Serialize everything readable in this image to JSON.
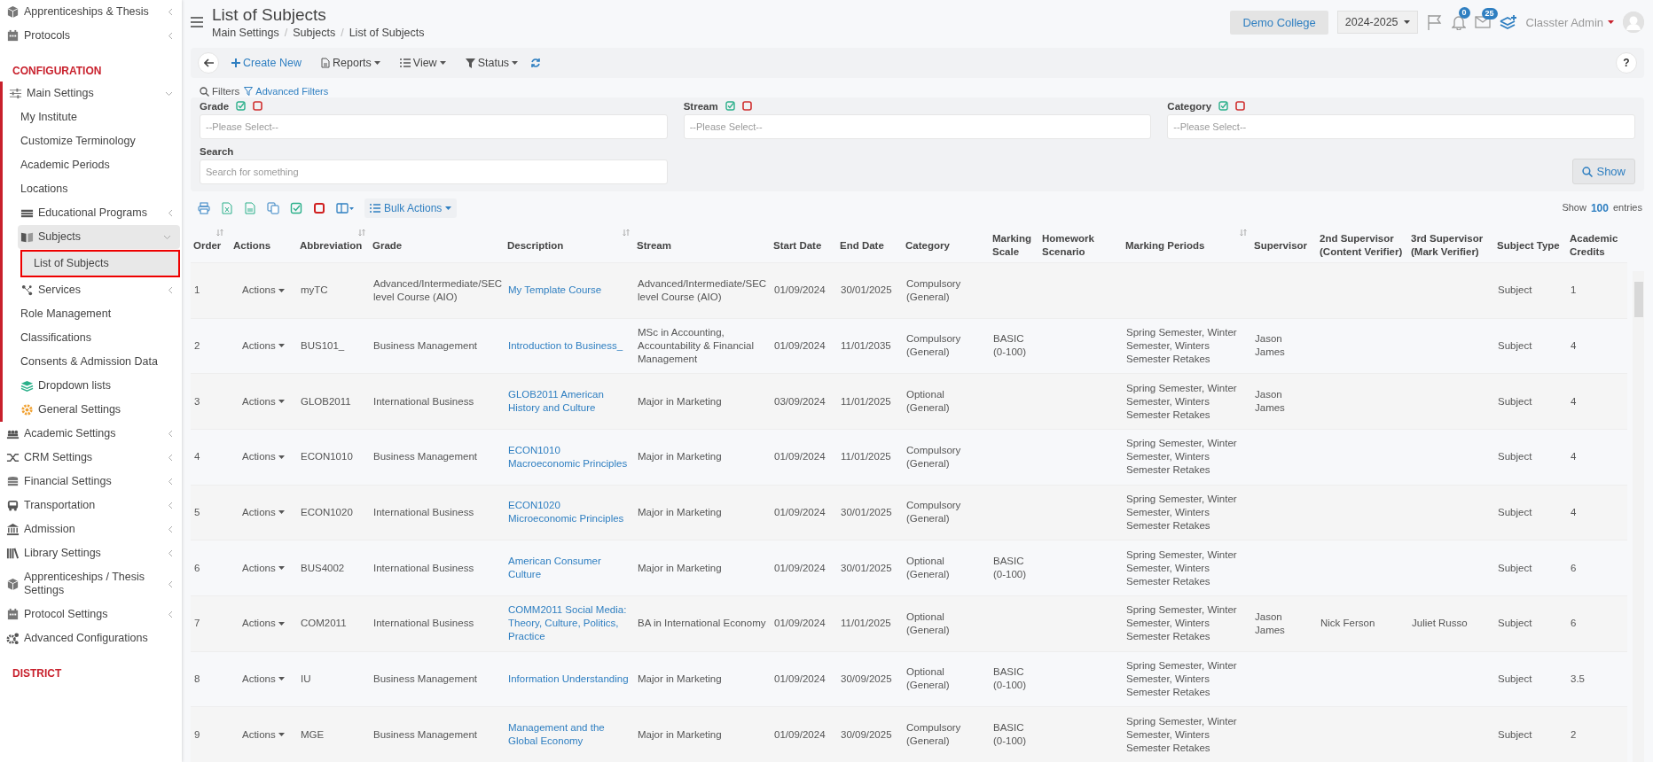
{
  "sidebar": {
    "items": [
      {
        "label": "Apprenticeships & Thesis",
        "kind": "item",
        "expanded": false,
        "selected": false
      },
      {
        "label": "Protocols",
        "kind": "item",
        "expanded": false,
        "selected": false
      },
      {
        "label": "CONFIGURATION",
        "kind": "section"
      },
      {
        "label": "Main Settings",
        "kind": "item",
        "expanded": true,
        "selected": false,
        "children": [
          {
            "label": "My Institute",
            "selected": false
          },
          {
            "label": "Customize Terminology",
            "selected": false
          },
          {
            "label": "Academic Periods",
            "selected": false
          },
          {
            "label": "Locations",
            "selected": false
          },
          {
            "label": "Educational Programs",
            "expanded": false,
            "selected": false
          },
          {
            "label": "Subjects",
            "expanded": true,
            "selected": false,
            "children": [
              {
                "label": "List of Subjects",
                "selected": true
              }
            ]
          },
          {
            "label": "Services",
            "expanded": false,
            "selected": false
          },
          {
            "label": "Role Management",
            "selected": false
          },
          {
            "label": "Classifications",
            "selected": false
          },
          {
            "label": "Consents & Admission Data",
            "selected": false
          },
          {
            "label": "Dropdown lists",
            "selected": false
          },
          {
            "label": "General Settings",
            "selected": false
          }
        ]
      },
      {
        "label": "Academic Settings",
        "kind": "item",
        "expanded": false,
        "selected": false
      },
      {
        "label": "CRM Settings",
        "kind": "item",
        "expanded": false,
        "selected": false
      },
      {
        "label": "Financial Settings",
        "kind": "item",
        "expanded": false,
        "selected": false
      },
      {
        "label": "Transportation",
        "kind": "item",
        "expanded": false,
        "selected": false
      },
      {
        "label": "Admission",
        "kind": "item",
        "expanded": false,
        "selected": false
      },
      {
        "label": "Library Settings",
        "kind": "item",
        "expanded": false,
        "selected": false
      },
      {
        "label": "Apprenticeships / Thesis Settings",
        "kind": "item",
        "expanded": false,
        "selected": false
      },
      {
        "label": "Protocol Settings",
        "kind": "item",
        "expanded": false,
        "selected": false
      },
      {
        "label": "Advanced Configurations",
        "kind": "item",
        "selected": false
      },
      {
        "label": "DISTRICT",
        "kind": "section"
      }
    ]
  },
  "header": {
    "title": "List of Subjects",
    "breadcrumbs": [
      "Main Settings",
      "Subjects",
      "List of Subjects"
    ],
    "breadcrumb_separator": "/",
    "institution": "Demo College",
    "year": "2024-2025",
    "notifications": "0",
    "messages": "25",
    "user": "Classter Admin"
  },
  "toolbar": {
    "buttons": [
      {
        "label": "Create New",
        "kind": "create"
      },
      {
        "label": "Reports",
        "kind": "reports"
      },
      {
        "label": "View",
        "kind": "view"
      },
      {
        "label": "Status",
        "kind": "status"
      }
    ],
    "help": "?"
  },
  "filters": {
    "title": "Filters",
    "advanced": "Advanced Filters",
    "fields": [
      {
        "label": "Grade",
        "placeholder": "--Please Select--"
      },
      {
        "label": "Stream",
        "placeholder": "--Please Select--"
      },
      {
        "label": "Category",
        "placeholder": "--Please Select--"
      }
    ],
    "search": {
      "label": "Search",
      "placeholder": "Search for something"
    },
    "show_button": "Show"
  },
  "table": {
    "bulk_actions": "Bulk Actions",
    "length": {
      "prefix": "Show",
      "value": "100",
      "suffix": "entries"
    },
    "columns": [
      {
        "label": "Order",
        "sortable": true,
        "kind": "text"
      },
      {
        "label": "Actions",
        "sortable": false,
        "kind": "actions"
      },
      {
        "label": "Abbreviation",
        "sortable": true,
        "kind": "text"
      },
      {
        "label": "Grade",
        "sortable": false,
        "kind": "text"
      },
      {
        "label": "Description",
        "sortable": true,
        "kind": "link"
      },
      {
        "label": "Stream",
        "sortable": false,
        "kind": "text"
      },
      {
        "label": "Start Date",
        "sortable": false,
        "kind": "text"
      },
      {
        "label": "End Date",
        "sortable": false,
        "kind": "text"
      },
      {
        "label": "Category",
        "sortable": false,
        "kind": "text"
      },
      {
        "label": "Marking Scale",
        "sortable": false,
        "kind": "text"
      },
      {
        "label": "Homework Scenario",
        "sortable": false,
        "kind": "text"
      },
      {
        "label": "Marking Periods",
        "sortable": true,
        "kind": "text"
      },
      {
        "label": "Supervisor",
        "sortable": false,
        "kind": "text"
      },
      {
        "label": "2nd Supervisor (Content Verifier)",
        "sortable": false,
        "kind": "text"
      },
      {
        "label": "3rd Supervisor (Mark Verifier)",
        "sortable": false,
        "kind": "text"
      },
      {
        "label": "Subject Type",
        "sortable": false,
        "kind": "text"
      },
      {
        "label": "Academic Credits",
        "sortable": false,
        "kind": "text"
      }
    ],
    "rows": [
      [
        "1",
        "Actions",
        "myTC",
        "Advanced/Intermediate/SEC level Course (AIO)",
        "My Template Course",
        "Advanced/Intermediate/SEC level Course (AIO)",
        "01/09/2024",
        "30/01/2025",
        "Compulsory (General)",
        null,
        null,
        null,
        null,
        null,
        null,
        "Subject",
        "1"
      ],
      [
        "2",
        "Actions",
        "BUS101_",
        "Business Management",
        "Introduction to Business_",
        "MSc in Accounting, Accountability & Financial Management",
        "01/09/2024",
        "11/01/2035",
        "Compulsory (General)",
        "BASIC (0-100)",
        null,
        "Spring Semester, Winter Semester, Winters Semester Retakes",
        "Jason James",
        null,
        null,
        "Subject",
        "4"
      ],
      [
        "3",
        "Actions",
        "GLOB2011",
        "International Business",
        "GLOB2011 American History and Culture",
        "Major in Marketing",
        "03/09/2024",
        "11/01/2025",
        "Optional (General)",
        null,
        null,
        "Spring Semester, Winter Semester, Winters Semester Retakes",
        "Jason James",
        null,
        null,
        "Subject",
        "4"
      ],
      [
        "4",
        "Actions",
        "ECON1010",
        "Business Management",
        "ECON1010 Macroeconomic Principles",
        "Major in Marketing",
        "01/09/2024",
        "11/01/2025",
        "Compulsory (General)",
        null,
        null,
        "Spring Semester, Winter Semester, Winters Semester Retakes",
        null,
        null,
        null,
        "Subject",
        "4"
      ],
      [
        "5",
        "Actions",
        "ECON1020",
        "International Business",
        "ECON1020 Microeconomic Principles",
        "Major in Marketing",
        "01/09/2024",
        "30/01/2025",
        "Compulsory (General)",
        null,
        null,
        "Spring Semester, Winter Semester, Winters Semester Retakes",
        null,
        null,
        null,
        "Subject",
        "4"
      ],
      [
        "6",
        "Actions",
        "BUS4002",
        "International Business",
        "American Consumer Culture",
        "Major in Marketing",
        "01/09/2024",
        "30/01/2025",
        "Optional (General)",
        "BASIC (0-100)",
        null,
        "Spring Semester, Winter Semester, Winters Semester Retakes",
        null,
        null,
        null,
        "Subject",
        "6"
      ],
      [
        "7",
        "Actions",
        "COM2011",
        "International Business",
        "COMM2011 Social Media: Theory, Culture, Politics, Practice",
        "BA in International Economy",
        "01/09/2024",
        "11/01/2025",
        "Optional (General)",
        null,
        null,
        "Spring Semester, Winter Semester, Winters Semester Retakes",
        "Jason James",
        "Nick Ferson",
        "Juliet Russo",
        "Subject",
        "6"
      ],
      [
        "8",
        "Actions",
        "IU",
        "Business Management",
        "Information Understanding",
        "Major in Marketing",
        "01/09/2024",
        "30/09/2025",
        "Optional (General)",
        "BASIC (0-100)",
        null,
        "Spring Semester, Winter Semester, Winters Semester Retakes",
        null,
        null,
        null,
        "Subject",
        "3.5"
      ],
      [
        "9",
        "Actions",
        "MGE",
        "Business Management",
        "Management and the Global Economy",
        "Major in Marketing",
        "01/09/2024",
        "30/09/2025",
        "Compulsory (General)",
        "BASIC (0-100)",
        null,
        "Spring Semester, Winter Semester, Winters Semester Retakes",
        null,
        null,
        null,
        "Subject",
        "2"
      ]
    ]
  }
}
